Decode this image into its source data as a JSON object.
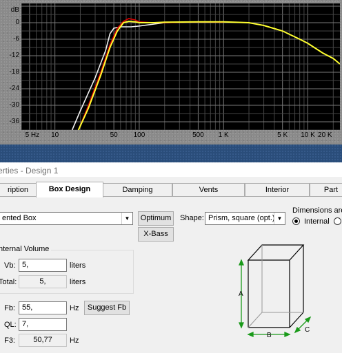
{
  "graph": {
    "y_unit": "dB",
    "y_ticks": [
      "0",
      "-6",
      "-12",
      "-18",
      "-24",
      "-30",
      "-36"
    ],
    "y_tick_values": [
      0,
      -6,
      -12,
      -18,
      -24,
      -30,
      -36
    ],
    "y_top_value": 6,
    "x_ticks": [
      "5 Hz",
      "10",
      "50",
      "100",
      "500",
      "1 K",
      "5 K",
      "10 K",
      "20 K"
    ],
    "x_tick_values": [
      5,
      10,
      50,
      100,
      500,
      1000,
      5000,
      10000,
      20000
    ],
    "colors": {
      "background": "#000000",
      "grid": "#5a5a5a",
      "red": "#e00000",
      "white": "#f0f0f0",
      "yellow": "#ffff30"
    }
  },
  "chart_data": {
    "type": "line",
    "xscale": "log",
    "xlim": [
      4,
      24000
    ],
    "ylim": [
      -39,
      7
    ],
    "xlabel": "",
    "ylabel": "dB",
    "series": [
      {
        "color": "#f0f0f0",
        "points": [
          [
            16,
            -39
          ],
          [
            20,
            -32
          ],
          [
            30,
            -20
          ],
          [
            40,
            -10
          ],
          [
            45,
            -4
          ],
          [
            50,
            -2
          ],
          [
            60,
            -1.5
          ],
          [
            80,
            -1.5
          ],
          [
            100,
            -1.2
          ],
          [
            150,
            -0.5
          ],
          [
            200,
            0
          ],
          [
            500,
            0.3
          ],
          [
            1000,
            0.2
          ]
        ]
      },
      {
        "color": "#e00000",
        "points": [
          [
            19,
            -39
          ],
          [
            25,
            -30
          ],
          [
            35,
            -18
          ],
          [
            45,
            -8
          ],
          [
            55,
            -2
          ],
          [
            65,
            0.5
          ],
          [
            75,
            1.5
          ],
          [
            90,
            1
          ],
          [
            100,
            0.3
          ],
          [
            150,
            0
          ],
          [
            200,
            0
          ],
          [
            500,
            0.3
          ],
          [
            1000,
            0.2
          ]
        ]
      },
      {
        "color": "#ffff30",
        "points": [
          [
            19,
            -39
          ],
          [
            25,
            -31
          ],
          [
            35,
            -19
          ],
          [
            45,
            -9
          ],
          [
            55,
            -3
          ],
          [
            65,
            0
          ],
          [
            75,
            0.5
          ],
          [
            90,
            0.3
          ],
          [
            100,
            0
          ],
          [
            150,
            0
          ],
          [
            200,
            0.2
          ],
          [
            500,
            0.3
          ],
          [
            1000,
            0.3
          ],
          [
            2000,
            0
          ],
          [
            3000,
            -1
          ],
          [
            5000,
            -3
          ],
          [
            8000,
            -6
          ],
          [
            10000,
            -7.5
          ],
          [
            15000,
            -11
          ],
          [
            20000,
            -13
          ],
          [
            24000,
            -15
          ]
        ]
      }
    ]
  },
  "dialog": {
    "title": "erties - Design 1",
    "tabs": [
      "ription",
      "Box Design",
      "Damping",
      "Vents",
      "Interior",
      "Part"
    ],
    "active_tab": "Box Design",
    "box_type": "ented Box",
    "optimum_label": "Optimum",
    "xbass_label": "X-Bass",
    "shape_label": "Shape:",
    "shape_value": "Prism, square (opt.)",
    "dimensions_label": "Dimensions are",
    "dimensions_option": "Internal",
    "internal_volume_label": "nternal Volume",
    "vb_label": "Vb:",
    "vb_value": "5,",
    "vb_unit": "liters",
    "total_label": "Total:",
    "total_value": "5,",
    "total_unit": "liters",
    "fb_label": "Fb:",
    "fb_value": "55,",
    "fb_unit": "Hz",
    "suggest_fb_label": "Suggest Fb",
    "ql_label": "QL:",
    "ql_value": "7,",
    "f3_label": "F3:",
    "f3_value": "50,77",
    "f3_unit": "Hz",
    "box_dims": {
      "a": "A",
      "b": "B",
      "c": "C"
    }
  }
}
